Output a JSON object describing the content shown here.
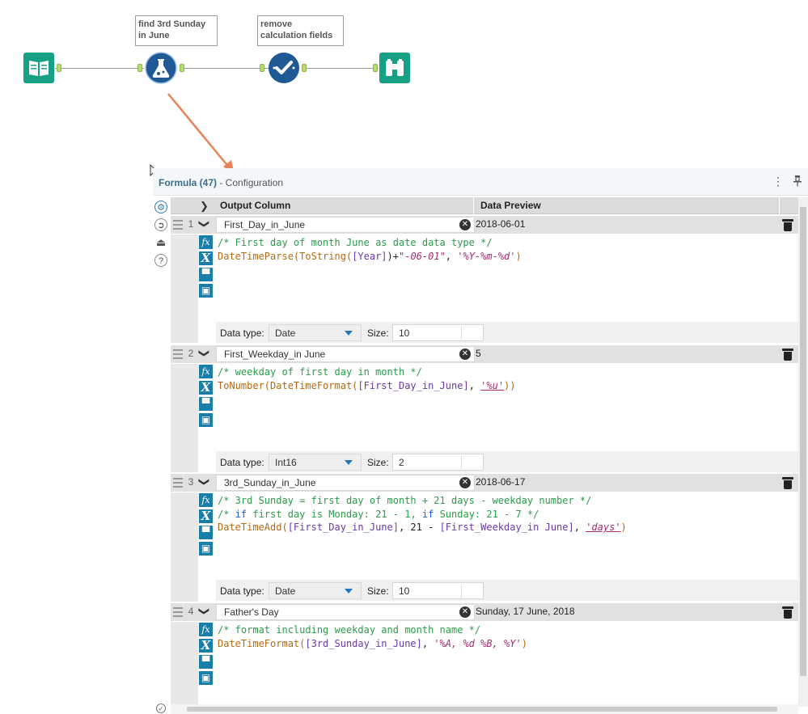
{
  "workflow": {
    "annotations": [
      {
        "text": "find 3rd Sunday\nin June"
      },
      {
        "text": "remove\ncalculation fields"
      }
    ]
  },
  "panel": {
    "title": "Formula (47)",
    "subtitle": " - Configuration",
    "menu_glyph": "⋮",
    "pin_glyph": "ꟷ"
  },
  "columns": {
    "output": "Output Column",
    "preview": "Data Preview"
  },
  "labels": {
    "data_type": "Data type:",
    "size": "Size:"
  },
  "rows": [
    {
      "num": "1",
      "name": "First_Day_in_June",
      "preview": "2018-06-01",
      "data_type": "Date",
      "size": "10"
    },
    {
      "num": "2",
      "name": "First_Weekday_in June",
      "preview": "5",
      "data_type": "Int16",
      "size": "2"
    },
    {
      "num": "3",
      "name": "3rd_Sunday_in_June",
      "preview": "2018-06-17",
      "data_type": "Date",
      "size": "10"
    },
    {
      "num": "4",
      "name": "Father's Day",
      "preview": "Sunday, 17 June, 2018",
      "data_type": "",
      "size": ""
    }
  ],
  "code": {
    "r1": {
      "l1": "/* First day of month June as date data type */",
      "l2_fn1": "DateTimeParse(",
      "l2_fn2": "ToString(",
      "l2_fld": "[Year]",
      "l2_a": ")+",
      "l2_str1": "\"-06-01\"",
      "l2_b": ", ",
      "l2_str2": "'%Y-%m-%d'",
      "l2_c": ")"
    },
    "r2": {
      "l1": "/* weekday of first day in month */",
      "l2_fn1": "ToNumber(",
      "l2_fn2": "DateTimeFormat(",
      "l2_fld": "[First_Day_in_June]",
      "l2_b": ", ",
      "l2_str": "'%u'",
      "l2_c": "))"
    },
    "r3": {
      "l1": "/* 3rd Sunday = first day of month + 21 days - weekday number */",
      "l2_a": "/* ",
      "l2_kw1": "if",
      "l2_b": " first day is Monday",
      "l2_c": ": 21 - 1, ",
      "l2_kw2": "if",
      "l2_d": " Sunday",
      "l2_e": ": 21 - 7 */",
      "l3_fn": "DateTimeAdd(",
      "l3_fld1": "[First_Day_in_June]",
      "l3_a": ", 21 - ",
      "l3_fld2": "[First_Weekday_in June]",
      "l3_b": ", ",
      "l3_str": "'days'",
      "l3_c": ")"
    },
    "r4": {
      "l1": "/* format including weekday and month name */",
      "l2_fn": "DateTimeFormat(",
      "l2_fld": "[3rd_Sunday_in_June]",
      "l2_b": ", ",
      "l2_str": "'%A, %d %B, %Y'",
      "l2_c": ")"
    }
  },
  "colors": {
    "tool_teal": "#16a085",
    "tool_blue": "#1f5a96",
    "arrow": "#e8825a"
  }
}
